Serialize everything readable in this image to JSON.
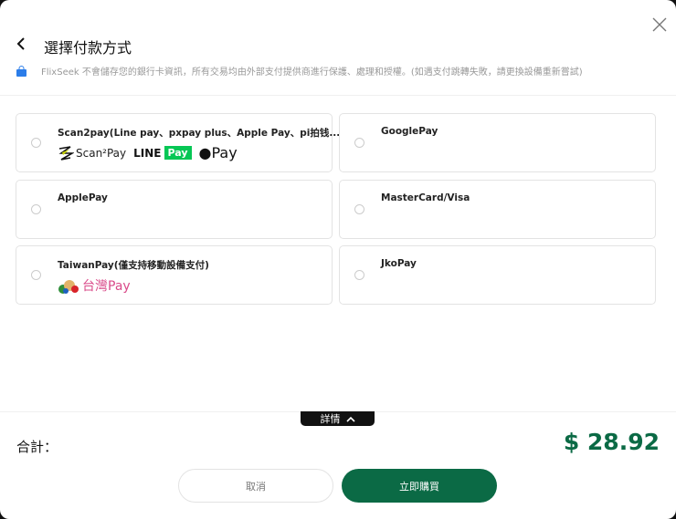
{
  "header": {
    "title": "選擇付款方式",
    "info": "FlixSeek 不會儲存您的銀行卡資訊，所有交易均由外部支付提供商進行保護、處理和授權。(如遇支付跳轉失敗，請更換設備重新嘗試)"
  },
  "methods": [
    {
      "label": "Scan2pay(Line pay、pxpay plus、Apple Pay、pi拍钱...",
      "logos": {
        "scan2pay": "Scan²Pay",
        "line": "LINE",
        "line_pay": "Pay",
        "apple": "Pay"
      }
    },
    {
      "label": "GooglePay"
    },
    {
      "label": "ApplePay"
    },
    {
      "label": "MasterCard/Visa"
    },
    {
      "label": "TaiwanPay(僅支持移動設備支付)",
      "logos": {
        "taiwanpay": "台灣Pay"
      }
    },
    {
      "label": "JkoPay"
    }
  ],
  "footer": {
    "details": "詳情",
    "total_label": "合計：",
    "total": "$ 28.92",
    "cancel": "取消",
    "buy": "立即購買"
  },
  "colors": {
    "accent": "#0b6a45",
    "line": "#06c755"
  }
}
